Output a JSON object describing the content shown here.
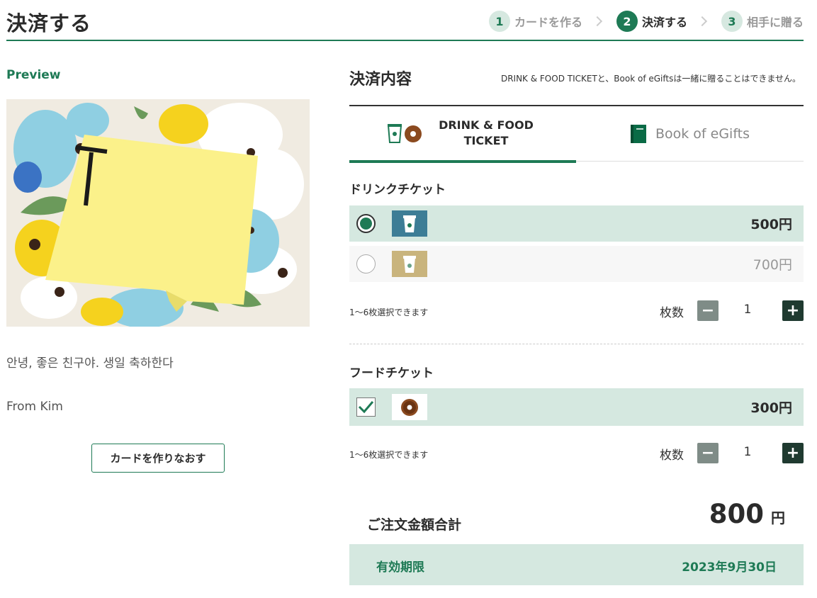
{
  "header": {
    "title": "決済する",
    "steps": [
      {
        "num": "1",
        "label": "カードを作る"
      },
      {
        "num": "2",
        "label": "決済する"
      },
      {
        "num": "3",
        "label": "相手に贈る"
      }
    ]
  },
  "left": {
    "preview_label": "Preview",
    "card_letter": "T",
    "message": "안녕, 좋은 친구야. 생일 축하한다",
    "from": "From Kim",
    "remake_button": "カードを作りなおす"
  },
  "summary": {
    "title": "決済内容",
    "note": "DRINK & FOOD TICKETと、Book of eGiftsは一緒に贈ることはできません。",
    "tabs": {
      "drink_food": "DRINK & FOOD TICKET",
      "book": "Book of eGifts"
    }
  },
  "drink": {
    "title": "ドリンクチケット",
    "options": [
      {
        "price": "500円",
        "selected": true
      },
      {
        "price": "700円",
        "selected": false
      }
    ],
    "qty_note": "1〜6枚選択できます",
    "qty_label": "枚数",
    "qty_value": "1",
    "minus": "−",
    "plus": "+"
  },
  "food": {
    "title": "フードチケット",
    "options": [
      {
        "price": "300円",
        "checked": true
      }
    ],
    "qty_note": "1〜6枚選択できます",
    "qty_label": "枚数",
    "qty_value": "1",
    "minus": "−",
    "plus": "+"
  },
  "total": {
    "label": "ご注文金額合計",
    "amount": "800",
    "unit": "円"
  },
  "expiry": {
    "label": "有効期限",
    "date": "2023年9月30日"
  },
  "colors": {
    "accent": "#1e7a55",
    "selected_row": "#d5e8e0",
    "dark_button": "#1f3a30",
    "muted_button": "#7f8c87"
  }
}
